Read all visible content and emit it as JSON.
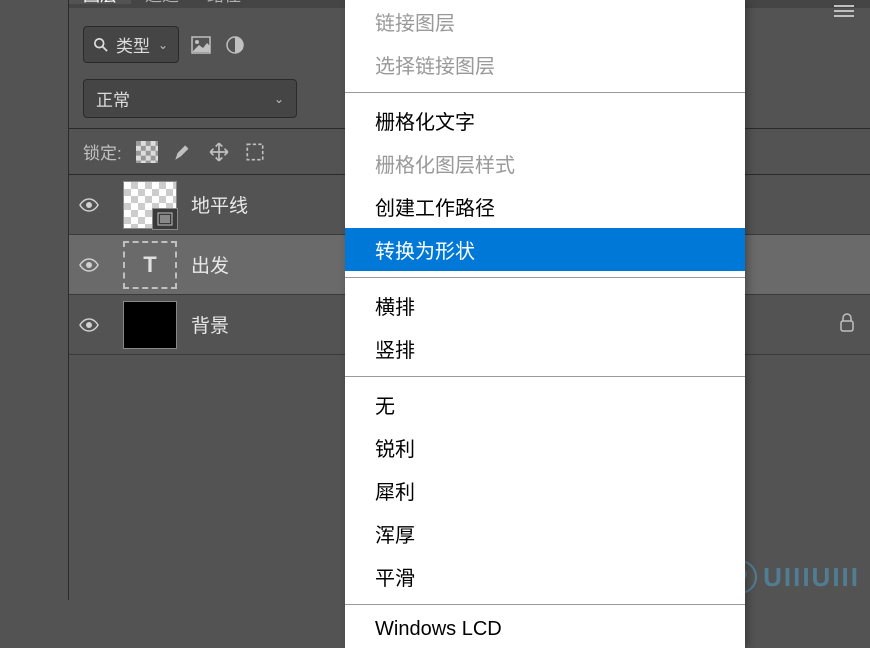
{
  "tabs": {
    "layers": "图层",
    "channels": "通道",
    "paths": "路径"
  },
  "filter": {
    "type_label": "类型"
  },
  "blend": {
    "mode": "正常"
  },
  "lock": {
    "label": "锁定:"
  },
  "layers": [
    {
      "name": "地平线"
    },
    {
      "name": "出发"
    },
    {
      "name": "背景"
    }
  ],
  "menu": {
    "link_layers": "链接图层",
    "select_linked": "选择链接图层",
    "rasterize_text": "栅格化文字",
    "rasterize_style": "栅格化图层样式",
    "create_path": "创建工作路径",
    "convert_shape": "转换为形状",
    "horizontal": "横排",
    "vertical": "竖排",
    "none": "无",
    "sharp": "锐利",
    "crisp": "犀利",
    "strong": "浑厚",
    "smooth": "平滑",
    "windows_lcd": "Windows LCD"
  },
  "watermark": {
    "text": "UIIIUIII"
  }
}
